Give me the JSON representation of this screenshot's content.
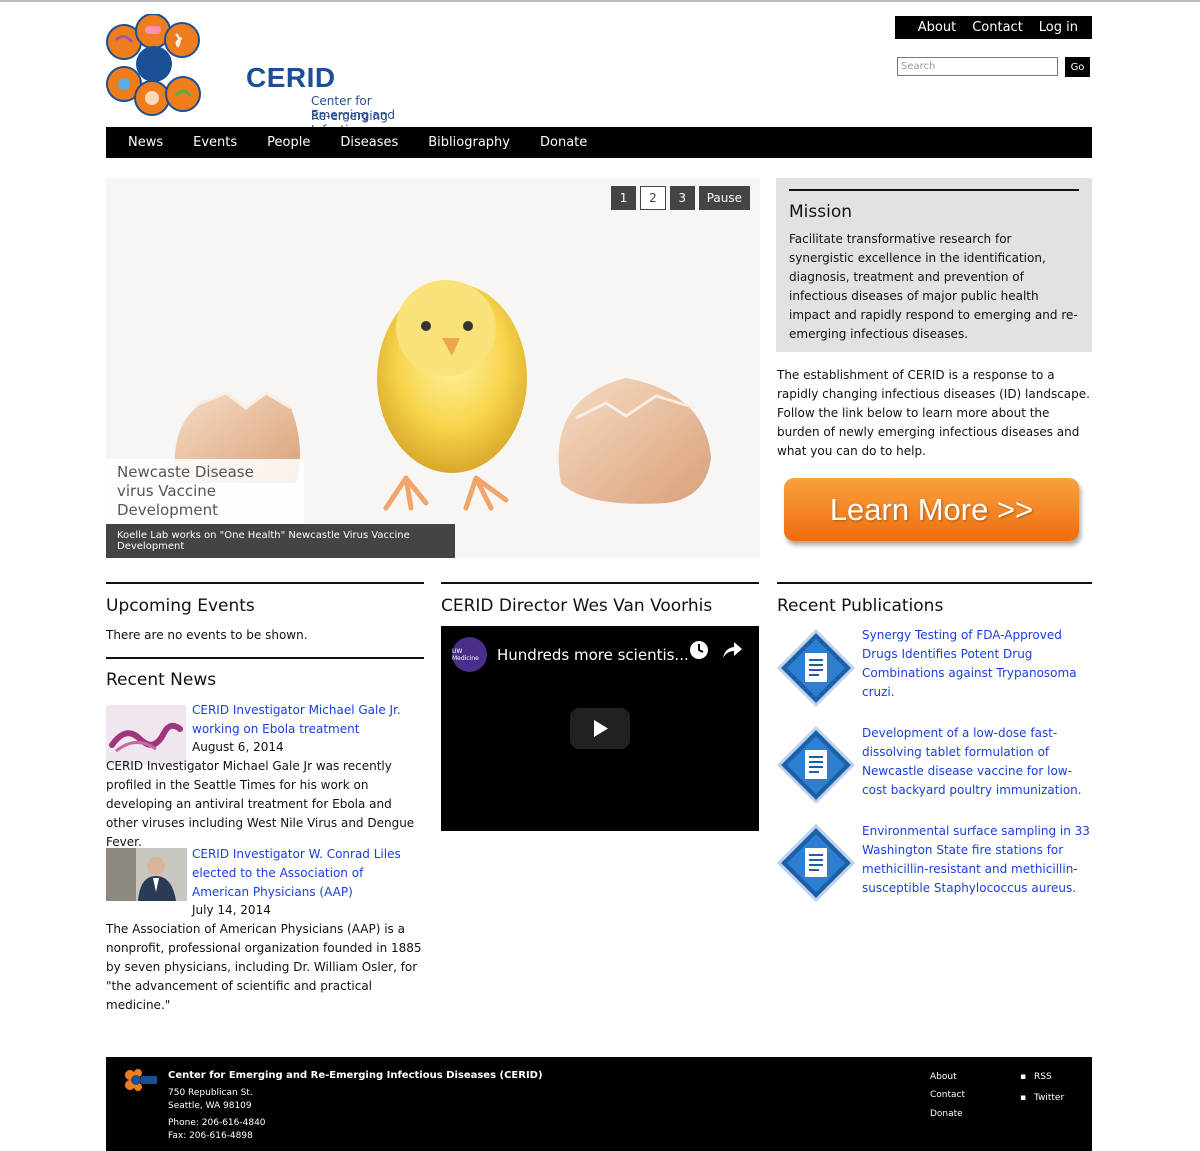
{
  "header": {
    "logo_word": "CERID",
    "logo_sub1": "Center for Emerging and",
    "logo_sub2": "Re-emerging Infectious Diseases",
    "util_nav": [
      "About",
      "Contact",
      "Log in"
    ],
    "search_placeholder": "Search",
    "search_button": "Go"
  },
  "nav": [
    "News",
    "Events",
    "People",
    "Diseases",
    "Bibliography",
    "Donate"
  ],
  "slideshow": {
    "buttons": [
      "1",
      "2",
      "3"
    ],
    "active": "2",
    "pause_label": "Pause",
    "title": "Newcaste Disease virus Vaccine Development",
    "caption": "Koelle Lab works on \"One Health\" Newcastle Virus Vaccine Development"
  },
  "mission": {
    "heading": "Mission",
    "text": "Facilitate transformative research for synergistic excellence in the identification, diagnosis, treatment and prevention of infectious diseases of major public health impact and rapidly respond to emerging and re-emerging infectious diseases."
  },
  "intro": "The establishment of CERID is a response to a rapidly changing infectious diseases (ID) landscape. Follow the link below to learn more about the burden of newly emerging infectious diseases and what you can do to help.",
  "learn_more": "Learn More >>",
  "events": {
    "heading": "Upcoming Events",
    "empty_text": "There are no events to be shown."
  },
  "news": {
    "heading": "Recent News",
    "items": [
      {
        "title": "CERID Investigator Michael Gale Jr. working on Ebola treatment",
        "date": "August 6, 2014",
        "summary": "CERID Investigator Michael Gale Jr was recently profiled in the Seattle Times for his work on developing an antiviral treatment for Ebola and other viruses including West Nile Virus and Dengue Fever."
      },
      {
        "title": "CERID Investigator W. Conrad Liles elected to the Association of American Physicians (AAP)",
        "date": "July 14, 2014",
        "summary": "The Association of American Physicians (AAP) is a nonprofit, professional organization founded in 1885 by seven physicians, including Dr. William Osler, for \"the advancement of scientific and practical medicine.\""
      }
    ]
  },
  "director": {
    "heading": "CERID Director Wes Van Voorhis",
    "video_title": "Hundreds more scientis...",
    "channel": "UW Medicine"
  },
  "publications": {
    "heading": "Recent Publications",
    "items": [
      "Synergy Testing of FDA-Approved Drugs Identifies Potent Drug Combinations against Trypanosoma cruzi.",
      "Development of a low-dose fast-dissolving tablet formulation of Newcastle disease vaccine for low-cost backyard poultry immunization.",
      "Environmental surface sampling in 33 Washington State fire stations for methicillin-resistant and methicillin-susceptible Staphylococcus aureus."
    ]
  },
  "footer": {
    "org": "Center for Emerging and Re-Emerging Infectious Diseases (CERID)",
    "address1": "750 Republican St.",
    "address2": "Seattle, WA 98109",
    "phone": "Phone: 206-616-4840",
    "fax": "Fax: 206-616-4898",
    "links": [
      "About",
      "Contact",
      "Donate"
    ],
    "social": [
      "RSS",
      "Twitter"
    ]
  },
  "colors": {
    "brand_blue": "#1a4f96",
    "link_blue": "#1a3ee0",
    "accent_orange": "#ef6c0e",
    "bar_black": "#000000"
  }
}
